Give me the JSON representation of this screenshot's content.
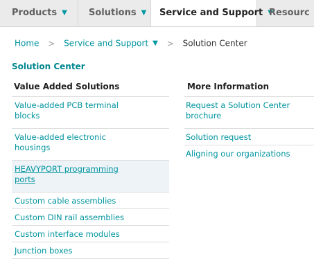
{
  "topnav": {
    "tabs": [
      {
        "label": "Products"
      },
      {
        "label": "Solutions"
      },
      {
        "label": "Service and Support"
      },
      {
        "label": "Resourc"
      }
    ]
  },
  "breadcrumb": {
    "home": "Home",
    "service": "Service and Support",
    "current": "Solution Center"
  },
  "page": {
    "section_title": "Solution Center"
  },
  "columns": {
    "left_heading": "Value Added Solutions",
    "right_heading": "More Information"
  },
  "left_items": [
    "Value-added PCB terminal blocks",
    "Value-added electronic housings",
    "HEAVYPORT programming ports",
    "Custom cable assemblies",
    "Custom DIN rail assemblies",
    "Custom interface modules",
    "Junction boxes"
  ],
  "right_items": [
    "Request a Solution Center brochure",
    "Solution request",
    "Aligning our organizations"
  ],
  "colors": {
    "accent_teal": "#00949e",
    "nav_background": "#ebebeb",
    "highlight_row": "#eef3f8"
  }
}
